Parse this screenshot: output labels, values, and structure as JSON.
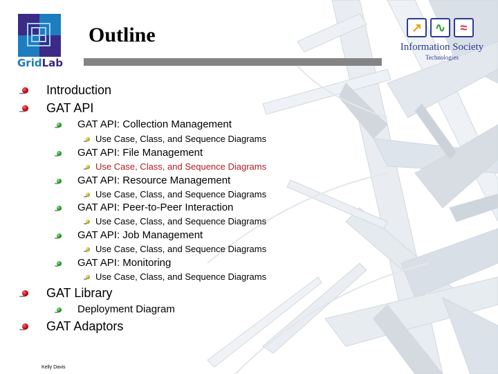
{
  "slide": {
    "title": "Outline",
    "footer": "Kelly Davis"
  },
  "logos": {
    "gridlab": {
      "word_part1": "Grid",
      "word_part2": "Lab"
    },
    "ist": {
      "line1": "Information Society",
      "line2": "Technologies",
      "box_glyphs": [
        "↗",
        "∿",
        "≈"
      ]
    }
  },
  "colors": {
    "title_bar": "#848484",
    "highlight_text": "#b01c22",
    "bullet_level1": "#c8101c",
    "bullet_level2": "#1f9a1c",
    "bullet_level3": "#b6a626"
  },
  "outline": [
    {
      "level": 1,
      "text": "Introduction"
    },
    {
      "level": 1,
      "text": "GAT API"
    },
    {
      "level": 2,
      "text": "GAT API: Collection Management"
    },
    {
      "level": 3,
      "text": "Use Case, Class, and Sequence Diagrams"
    },
    {
      "level": 2,
      "text": "GAT API: File Management"
    },
    {
      "level": 3,
      "text": "Use Case, Class, and Sequence Diagrams",
      "highlighted": true
    },
    {
      "level": 2,
      "text": "GAT API: Resource Management"
    },
    {
      "level": 3,
      "text": "Use Case, Class, and Sequence Diagrams"
    },
    {
      "level": 2,
      "text": "GAT API: Peer-to-Peer Interaction"
    },
    {
      "level": 3,
      "text": "Use Case, Class, and Sequence Diagrams"
    },
    {
      "level": 2,
      "text": "GAT API: Job Management"
    },
    {
      "level": 3,
      "text": "Use Case, Class, and Sequence Diagrams"
    },
    {
      "level": 2,
      "text": "GAT API: Monitoring"
    },
    {
      "level": 3,
      "text": "Use Case, Class, and Sequence Diagrams"
    },
    {
      "level": 1,
      "text": "GAT Library"
    },
    {
      "level": 2,
      "text": "Deployment Diagram"
    },
    {
      "level": 1,
      "text": "GAT Adaptors"
    }
  ]
}
